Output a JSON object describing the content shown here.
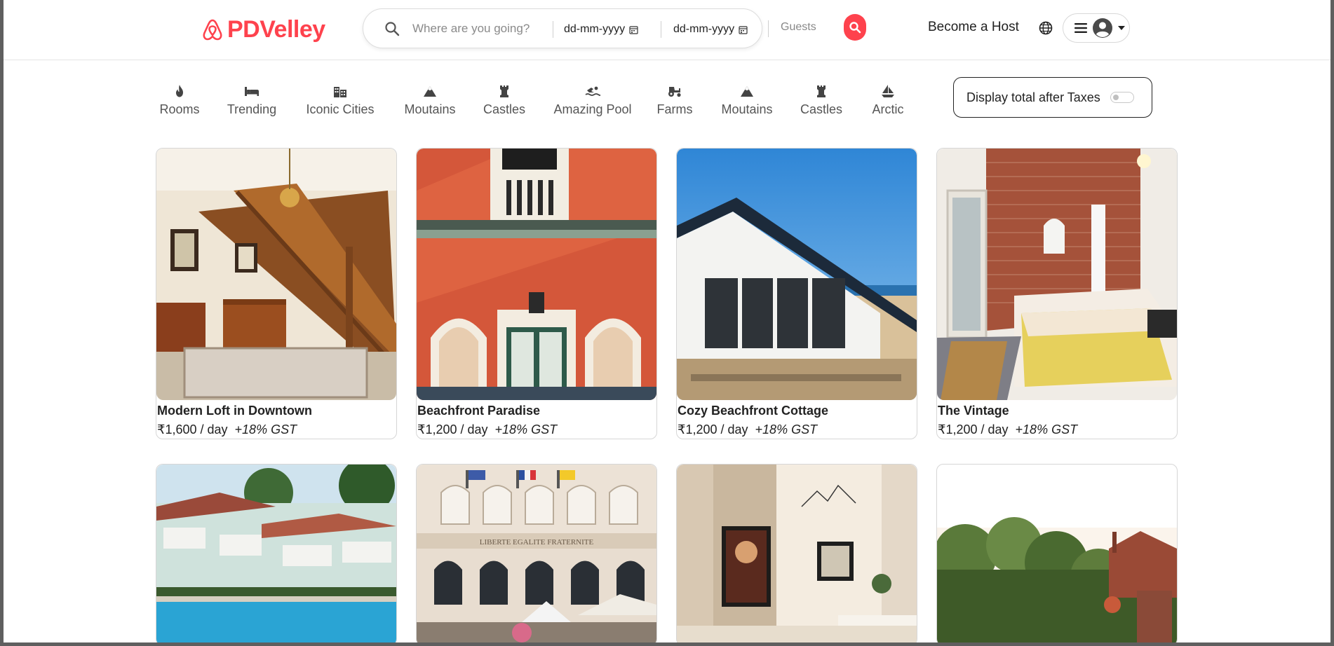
{
  "brand": {
    "name": "PDVelley",
    "color": "#fe424d"
  },
  "search": {
    "where_placeholder": "Where are you going?",
    "checkin": "dd-mm-yyyy",
    "checkout": "dd-mm-yyyy",
    "guests": "Guests",
    "button_icon": "search-icon"
  },
  "nav": {
    "host_label": "Become a Host",
    "globe_icon": "globe-icon",
    "menu_icon": "hamburger-icon",
    "avatar_icon": "user-avatar-icon"
  },
  "filters": [
    {
      "label": "Rooms",
      "icon": "fire-icon"
    },
    {
      "label": "Trending",
      "icon": "bed-icon"
    },
    {
      "label": "Iconic Cities",
      "icon": "city-icon"
    },
    {
      "label": "Moutains",
      "icon": "mountain-icon"
    },
    {
      "label": "Castles",
      "icon": "castle-icon"
    },
    {
      "label": "Amazing Pool",
      "icon": "swimmer-icon"
    },
    {
      "label": "Farms",
      "icon": "tractor-icon"
    },
    {
      "label": "Moutains",
      "icon": "mountain-icon"
    },
    {
      "label": "Castles",
      "icon": "castle-icon"
    },
    {
      "label": "Arctic",
      "icon": "sailboat-icon"
    }
  ],
  "tax_toggle": {
    "label": "Display total after Taxes",
    "on": false
  },
  "listings": [
    {
      "title": "Modern Loft in Downtown",
      "price": "₹1,600 / day",
      "gst": "+18% GST",
      "image": "staircase-interior"
    },
    {
      "title": "Beachfront Paradise",
      "price": "₹1,200 / day",
      "gst": "+18% GST",
      "image": "orange-building-facade"
    },
    {
      "title": "Cozy Beachfront Cottage",
      "price": "₹1,200 / day",
      "gst": "+18% GST",
      "image": "beach-cottage"
    },
    {
      "title": "The Vintage",
      "price": "₹1,200 / day",
      "gst": "+18% GST",
      "image": "brick-wall-bedroom"
    },
    {
      "title": "",
      "price": "",
      "gst": "",
      "image": "resort-pool"
    },
    {
      "title": "",
      "price": "",
      "gst": "",
      "image": "colonial-building"
    },
    {
      "title": "",
      "price": "",
      "gst": "",
      "image": "poster-interior"
    },
    {
      "title": "",
      "price": "",
      "gst": "",
      "image": "garden-rooftop"
    }
  ],
  "row2_sign": "LIBERTE   EGALITE   FRATERNITE"
}
